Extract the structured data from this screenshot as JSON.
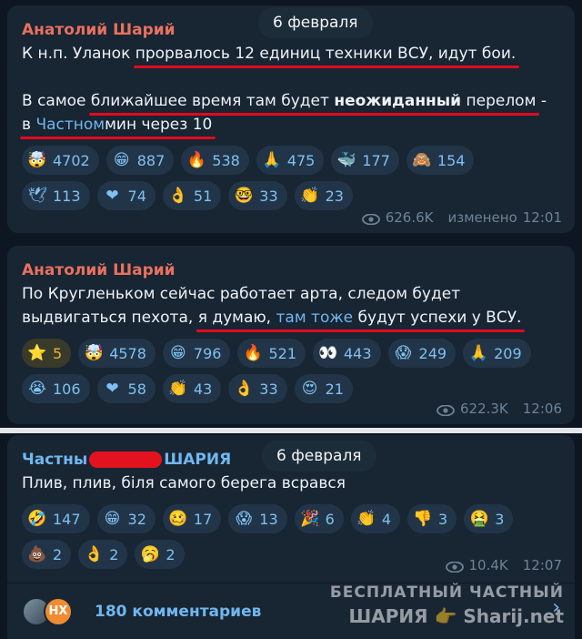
{
  "msg1": {
    "author": "Анатолий Шарий",
    "date": "6 февраля",
    "line1_a": "К н.п. Уланок ",
    "line1_ul": "прорвалось 12 единиц техники ВСУ, идут бои.",
    "line3_a": "В самое ",
    "line3_ul1": "ближайшее время там будет ",
    "line3_bold": "неожиданный",
    "line3_ul2": " перелом",
    "line3_end": " -",
    "line4_a": "в ",
    "line4_link": "Частном",
    "line4_b": " мин через 10",
    "reactions": [
      {
        "icon": "cowboy-face",
        "emoji": "🤯",
        "count": "4702"
      },
      {
        "icon": "grinning-face",
        "emoji": "😁",
        "count": "887"
      },
      {
        "icon": "fire",
        "emoji": "🔥",
        "count": "538"
      },
      {
        "icon": "folded-hands",
        "emoji": "🙏",
        "count": "475"
      },
      {
        "icon": "whale",
        "emoji": "🐳",
        "count": "177"
      },
      {
        "icon": "see-no-evil-monkey",
        "emoji": "🙈",
        "count": "154"
      },
      {
        "icon": "dove",
        "emoji": "🕊",
        "count": "113"
      },
      {
        "icon": "heart",
        "emoji": "❤",
        "count": "74"
      },
      {
        "icon": "ok-hand",
        "emoji": "👌",
        "count": "51"
      },
      {
        "icon": "nerd-face",
        "emoji": "🤓",
        "count": "33"
      },
      {
        "icon": "clapping-hands",
        "emoji": "👏",
        "count": "23"
      }
    ],
    "views": "626.6K",
    "edited": "изменено",
    "time": "12:01"
  },
  "msg2": {
    "author": "Анатолий Шарий",
    "line1": "По Кругленьком сейчас работает арта, следом будет",
    "line2_a": "выдвигаться пехота,  ",
    "line2_ul1": "я думаю, ",
    "line2_link": "там тоже",
    "line2_ul2": " будут успехи у ВСУ.",
    "reactions": [
      {
        "icon": "star",
        "emoji": "⭐",
        "count": "5",
        "gold": true
      },
      {
        "icon": "cowboy-face",
        "emoji": "🤯",
        "count": "4578"
      },
      {
        "icon": "grinning-face",
        "emoji": "😁",
        "count": "796"
      },
      {
        "icon": "fire",
        "emoji": "🔥",
        "count": "521"
      },
      {
        "icon": "eyes",
        "emoji": "👀",
        "count": "443"
      },
      {
        "icon": "screaming-face",
        "emoji": "😱",
        "count": "249"
      },
      {
        "icon": "folded-hands",
        "emoji": "🙏",
        "count": "209"
      },
      {
        "icon": "crying-face",
        "emoji": "😭",
        "count": "106"
      },
      {
        "icon": "heart",
        "emoji": "❤",
        "count": "58"
      },
      {
        "icon": "clapping-hands",
        "emoji": "👏",
        "count": "43"
      },
      {
        "icon": "ok-hand",
        "emoji": "👌",
        "count": "33"
      },
      {
        "icon": "heart-eyes-face",
        "emoji": "😍",
        "count": "21"
      }
    ],
    "views": "622.3K",
    "time": "12:06"
  },
  "msg3": {
    "author_a": "Частны",
    "author_b": "ШАРИЯ",
    "date": "6 февраля",
    "text": "Плив, плив, біля самого берега всрався",
    "reactions": [
      {
        "icon": "rofl-face",
        "emoji": "🤣",
        "count": "147"
      },
      {
        "icon": "grinning-face",
        "emoji": "😁",
        "count": "32"
      },
      {
        "icon": "woozy-face",
        "emoji": "🥴",
        "count": "17"
      },
      {
        "icon": "screaming-face",
        "emoji": "😱",
        "count": "13"
      },
      {
        "icon": "party-popper",
        "emoji": "🎉",
        "count": "6"
      },
      {
        "icon": "clapping-hands",
        "emoji": "👏",
        "count": "4"
      },
      {
        "icon": "thumbs-down",
        "emoji": "👎",
        "count": "3"
      },
      {
        "icon": "vomiting-face",
        "emoji": "🤮",
        "count": "3"
      },
      {
        "icon": "poop",
        "emoji": "💩",
        "count": "2"
      },
      {
        "icon": "ok-hand",
        "emoji": "👌",
        "count": "2"
      },
      {
        "icon": "yawning-face",
        "emoji": "🥱",
        "count": "2"
      }
    ],
    "views": "10.4K",
    "time": "12:07",
    "avatar_text": "НХ",
    "comments": "180 комментариев"
  },
  "watermark": {
    "line1": "БЕСПЛАТНЫЙ ЧАСТНЫЙ",
    "line2": "ШАРИЯ 👉 Sharij.net"
  },
  "colors": {
    "background": "#0e1621",
    "bubble": "#182533",
    "author_red": "#e8715f",
    "author_blue": "#70b7ee",
    "underline_red": "#e20a1e",
    "link": "#70b7ee"
  }
}
